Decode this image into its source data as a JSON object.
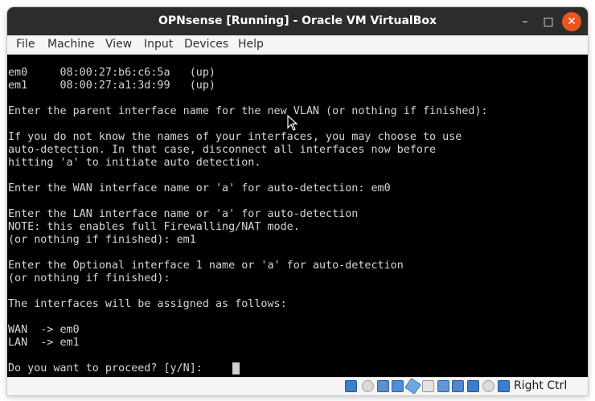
{
  "window": {
    "title": "OPNsense [Running] - Oracle VM VirtualBox",
    "controls": {
      "minimize": "–",
      "maximize": "□",
      "close": "✕"
    }
  },
  "menu": [
    "File",
    "Machine",
    "View",
    "Input",
    "Devices",
    "Help"
  ],
  "console": {
    "lines": [
      "em0     08:00:27:b6:c6:5a   (up)",
      "em1     08:00:27:a1:3d:99   (up)",
      "",
      "Enter the parent interface name for the new VLAN (or nothing if finished):",
      "",
      "If you do not know the names of your interfaces, you may choose to use",
      "auto-detection. In that case, disconnect all interfaces now before",
      "hitting 'a' to initiate auto detection.",
      "",
      "Enter the WAN interface name or 'a' for auto-detection: em0",
      "",
      "Enter the LAN interface name or 'a' for auto-detection",
      "NOTE: this enables full Firewalling/NAT mode.",
      "(or nothing if finished): em1",
      "",
      "Enter the Optional interface 1 name or 'a' for auto-detection",
      "(or nothing if finished):",
      "",
      "The interfaces will be assigned as follows:",
      "",
      "WAN  -> em0",
      "LAN  -> em1",
      "",
      "Do you want to proceed? [y/N]:"
    ]
  },
  "statusbar": {
    "icons": [
      "hard-disk-icon",
      "optical-drive-icon",
      "audio-icon",
      "network-icon",
      "usb-icon",
      "shared-folders-icon",
      "display-icon",
      "video-capture-icon",
      "recording-icon",
      "cpu-icon",
      "mouse-integration-icon",
      "keyboard-icon"
    ],
    "host_key": "Right Ctrl"
  },
  "colors": {
    "titlebar": "#2c2c2c",
    "close_button": "#e95420",
    "console_bg": "#000000",
    "console_text": "#d6d6d6"
  }
}
